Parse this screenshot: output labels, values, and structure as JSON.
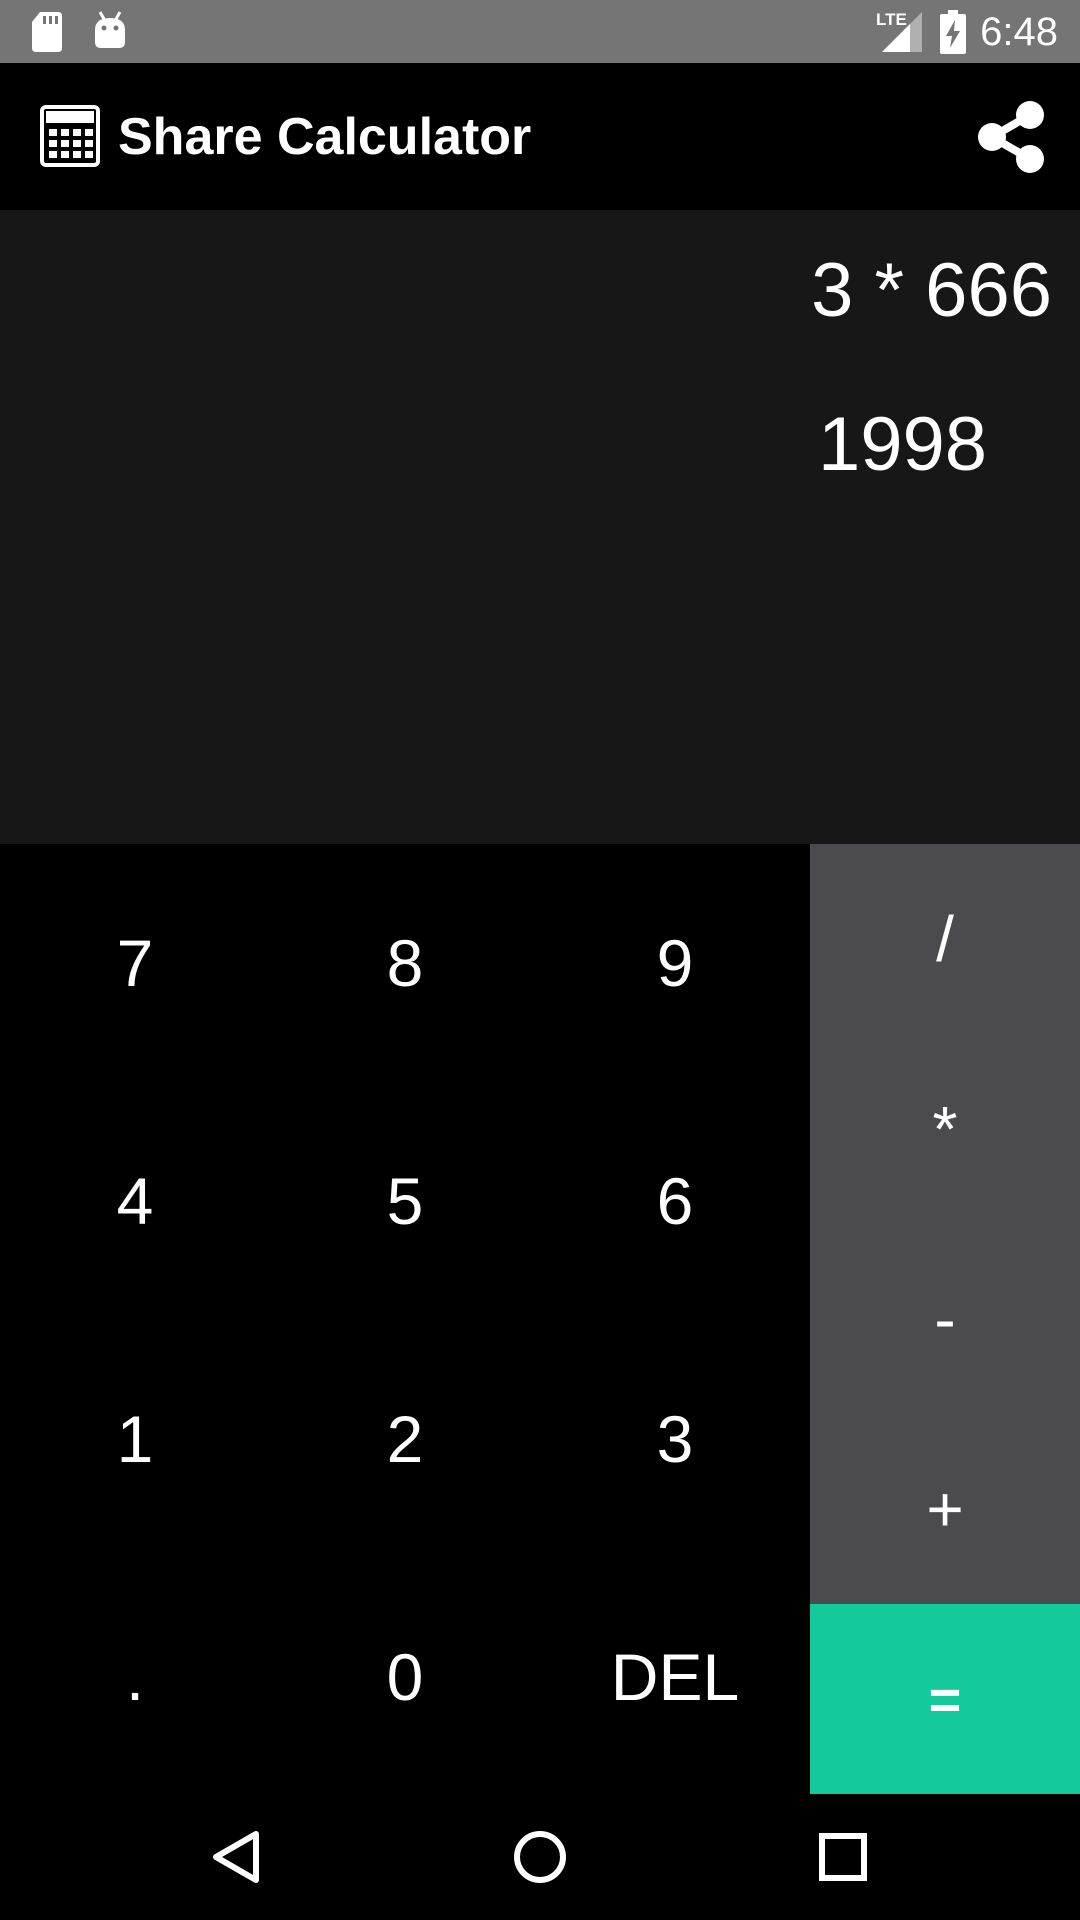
{
  "status_bar": {
    "time": "6:48",
    "network_label": "LTE",
    "icons": [
      "sd-card-icon",
      "android-debug-icon",
      "signal-icon",
      "battery-charging-icon"
    ]
  },
  "app_bar": {
    "title": "Share Calculator",
    "logo_icon": "calculator-icon",
    "share_icon": "share-icon"
  },
  "display": {
    "expression": "3 * 666",
    "result": "1998"
  },
  "keypad": {
    "rows": [
      [
        "7",
        "8",
        "9"
      ],
      [
        "4",
        "5",
        "6"
      ],
      [
        "1",
        "2",
        "3"
      ],
      [
        ".",
        "0",
        "DEL"
      ]
    ]
  },
  "operators": [
    "/",
    "*",
    "-",
    "+"
  ],
  "equals_label": "=",
  "colors": {
    "status_bar": "#757575",
    "display_bg": "#171717",
    "operator_panel": "#4a4a4f",
    "equals_accent": "#14c99b"
  },
  "nav_bar": {
    "icons": [
      "back-icon",
      "home-icon",
      "recents-icon"
    ]
  }
}
